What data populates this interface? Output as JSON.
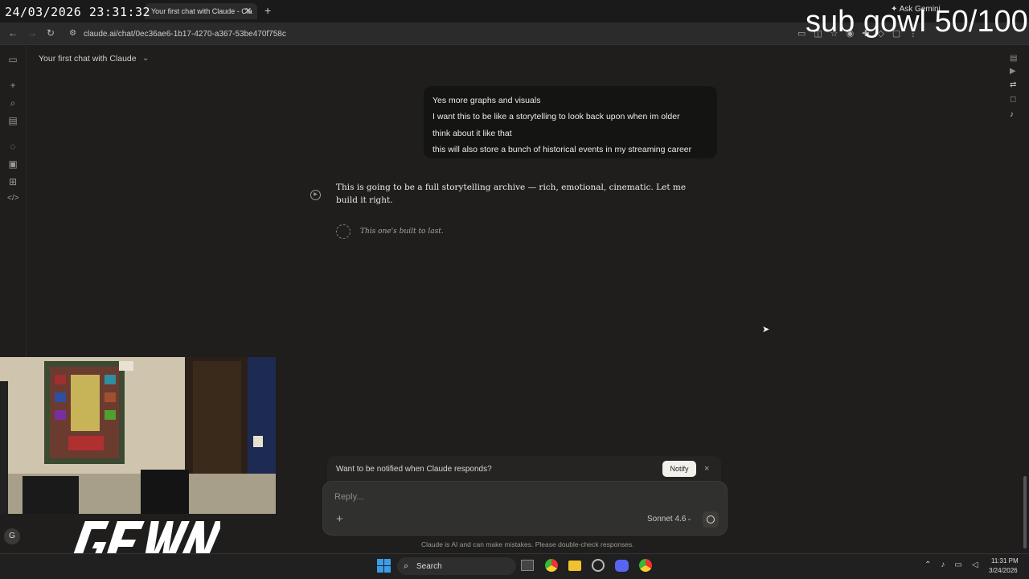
{
  "overlay": {
    "timestamp": "24/03/2026 23:31:32",
    "counter": "sub gowl 50/100"
  },
  "browser": {
    "tab_title": "Your first chat with Claude - Cla",
    "url": "claude.ai/chat/0ec36ae6-1b17-4270-a367-53be470f758c",
    "ask_gemini": "Ask Gemini"
  },
  "app": {
    "chat_title": "Your first chat with Claude",
    "sidebar_icons": [
      "sidebar-toggle-icon",
      "new-chat-icon",
      "search-icon",
      "projects-icon",
      "chats-icon",
      "artifacts-icon",
      "apps-icon",
      "code-icon"
    ]
  },
  "conversation": {
    "user_lines": [
      "Yes more graphs and visuals",
      "I want this to be like a storytelling to look back upon when im older",
      "think about it like that",
      "this will also store a bunch of historical events in my streaming career"
    ],
    "assistant_text": "This is going to be a full storytelling archive — rich, emotional, cinematic. Let me build it right.",
    "status": "This one's built to last."
  },
  "notify": {
    "text": "Want to be notified when Claude responds?",
    "button": "Notify"
  },
  "composer": {
    "placeholder": "Reply...",
    "model": "Sonnet 4.6",
    "disclaimer": "Claude is AI and can make mistakes. Please double-check responses."
  },
  "user": {
    "avatar_initial": "G"
  },
  "taskbar": {
    "search": "Search",
    "time": "11:31 PM",
    "date": "3/24/2026"
  },
  "colors": {
    "background": "#1f1e1d",
    "bubble": "#141413",
    "composer": "#30302e"
  }
}
